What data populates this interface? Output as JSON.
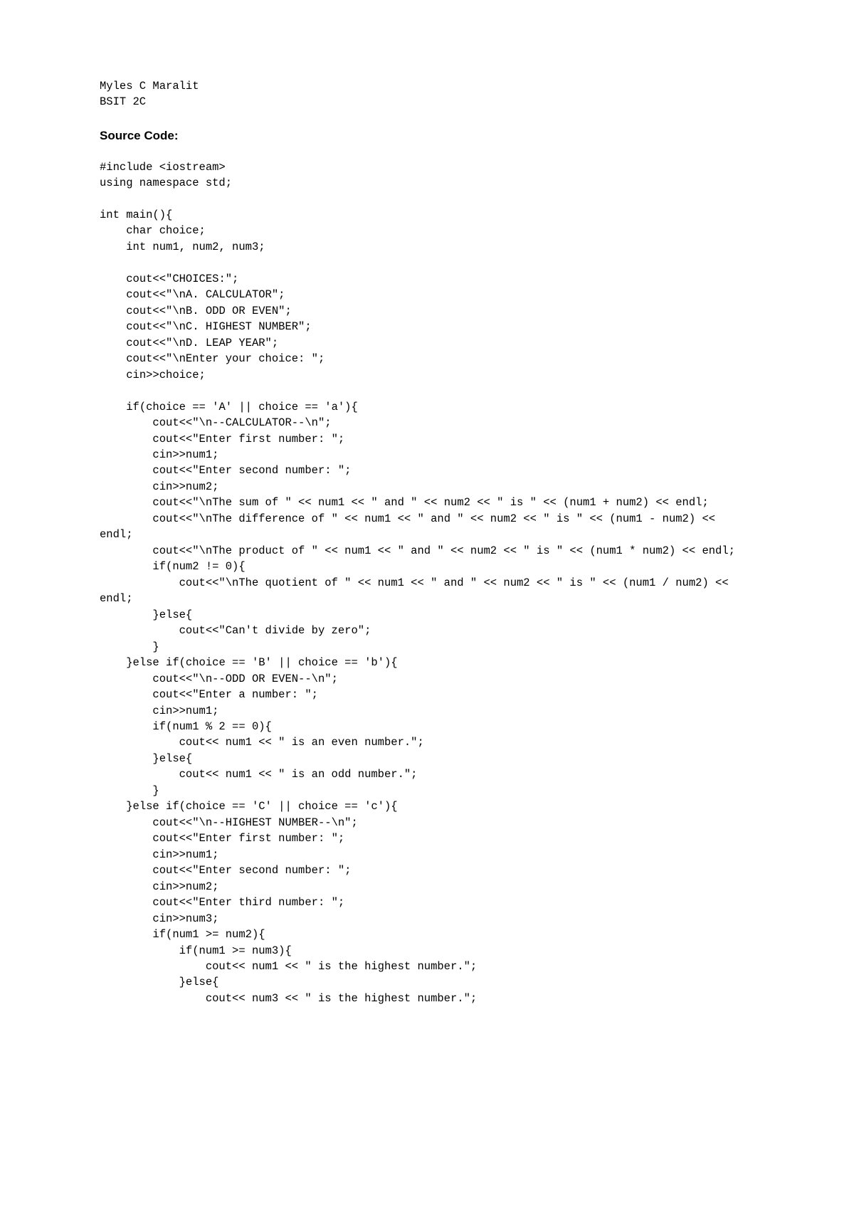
{
  "header": {
    "name": "Myles C Maralit",
    "section": "BSIT 2C"
  },
  "sectionTitle": "Source Code:",
  "code": "#include <iostream>\nusing namespace std;\n\nint main(){\n    char choice;\n    int num1, num2, num3;\n\n    cout<<\"CHOICES:\";\n    cout<<\"\\nA. CALCULATOR\";\n    cout<<\"\\nB. ODD OR EVEN\";\n    cout<<\"\\nC. HIGHEST NUMBER\";\n    cout<<\"\\nD. LEAP YEAR\";\n    cout<<\"\\nEnter your choice: \";\n    cin>>choice;\n\n    if(choice == 'A' || choice == 'a'){\n        cout<<\"\\n--CALCULATOR--\\n\";\n        cout<<\"Enter first number: \";\n        cin>>num1;\n        cout<<\"Enter second number: \";\n        cin>>num2;\n        cout<<\"\\nThe sum of \" << num1 << \" and \" << num2 << \" is \" << (num1 + num2) << endl;\n        cout<<\"\\nThe difference of \" << num1 << \" and \" << num2 << \" is \" << (num1 - num2) << endl;\n        cout<<\"\\nThe product of \" << num1 << \" and \" << num2 << \" is \" << (num1 * num2) << endl;\n        if(num2 != 0){\n            cout<<\"\\nThe quotient of \" << num1 << \" and \" << num2 << \" is \" << (num1 / num2) << endl;\n        }else{\n            cout<<\"Can't divide by zero\";\n        }\n    }else if(choice == 'B' || choice == 'b'){\n        cout<<\"\\n--ODD OR EVEN--\\n\";\n        cout<<\"Enter a number: \";\n        cin>>num1;\n        if(num1 % 2 == 0){\n            cout<< num1 << \" is an even number.\";\n        }else{\n            cout<< num1 << \" is an odd number.\";\n        }\n    }else if(choice == 'C' || choice == 'c'){\n        cout<<\"\\n--HIGHEST NUMBER--\\n\";\n        cout<<\"Enter first number: \";\n        cin>>num1;\n        cout<<\"Enter second number: \";\n        cin>>num2;\n        cout<<\"Enter third number: \";\n        cin>>num3;\n        if(num1 >= num2){\n            if(num1 >= num3){\n                cout<< num1 << \" is the highest number.\";\n            }else{\n                cout<< num3 << \" is the highest number.\";"
}
